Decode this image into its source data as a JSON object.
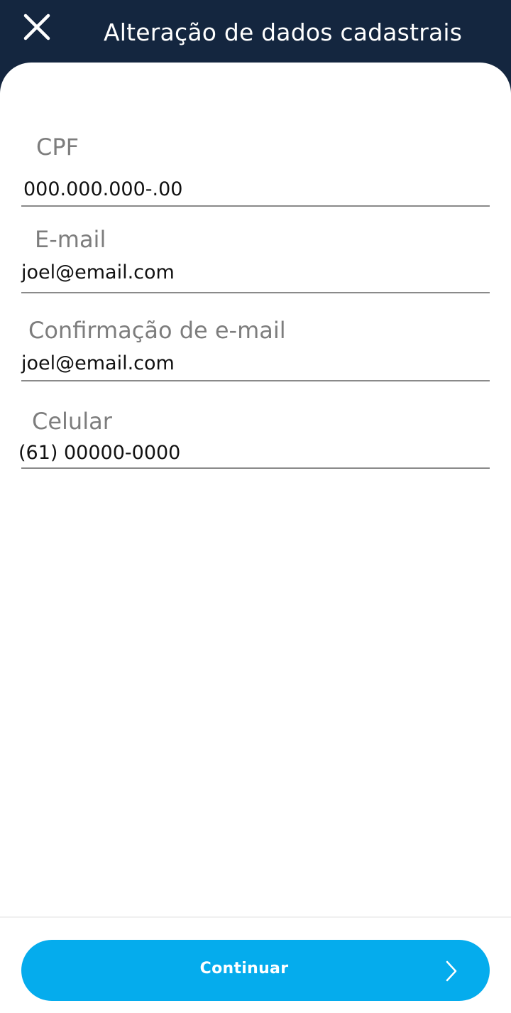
{
  "header": {
    "title": "Alteração de dados cadastrais",
    "close_icon": "close-icon"
  },
  "form": {
    "cpf": {
      "label": "CPF",
      "value": "000.000.000-.00"
    },
    "email": {
      "label": "E-mail",
      "value": "joel@email.com"
    },
    "email_confirm": {
      "label": "Confirmação de e-mail",
      "value": "joel@email.com"
    },
    "phone": {
      "label": "Celular",
      "value": "(61) 00000-0000"
    }
  },
  "footer": {
    "continue_label": "Continuar",
    "continue_icon": "chevron-right-icon"
  },
  "colors": {
    "header_bg": "#14263f",
    "accent": "#05aced",
    "label": "#7d7d7d"
  }
}
